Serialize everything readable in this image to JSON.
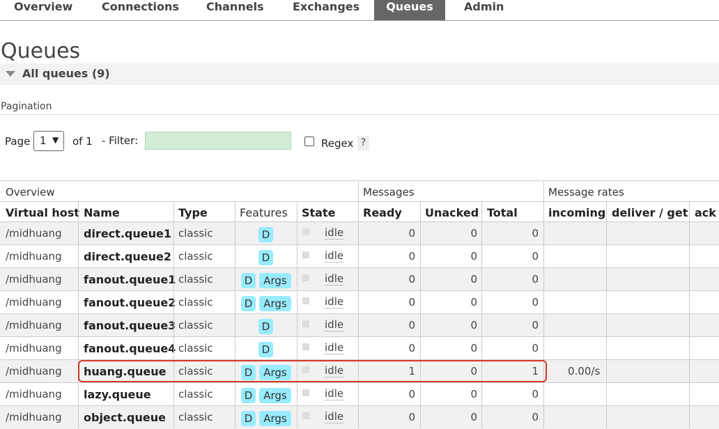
{
  "nav": {
    "tabs": [
      {
        "label": "Overview"
      },
      {
        "label": "Connections"
      },
      {
        "label": "Channels"
      },
      {
        "label": "Exchanges"
      },
      {
        "label": "Queues"
      },
      {
        "label": "Admin"
      }
    ],
    "active": "Queues"
  },
  "page": {
    "title": "Queues",
    "section_title": "All queues (9)"
  },
  "pagination": {
    "heading": "Pagination",
    "page_label": "Page",
    "page_value": "1",
    "of_label": "of 1",
    "filter_label": "- Filter:",
    "filter_value": "",
    "regex_label": "Regex",
    "regex_checked": false,
    "help_label": "?"
  },
  "table": {
    "groups": {
      "overview": "Overview",
      "messages": "Messages",
      "rates": "Message rates"
    },
    "columns": {
      "vhost": "Virtual host",
      "name": "Name",
      "type": "Type",
      "features": "Features",
      "state": "State",
      "ready": "Ready",
      "unacked": "Unacked",
      "total": "Total",
      "incoming": "incoming",
      "deliver": "deliver / get",
      "ack": "ack"
    },
    "rows": [
      {
        "vhost": "/midhuang",
        "name": "direct.queue1",
        "type": "classic",
        "d": "D",
        "args": "",
        "state": "idle",
        "ready": "0",
        "unacked": "0",
        "total": "0",
        "incoming": ""
      },
      {
        "vhost": "/midhuang",
        "name": "direct.queue2",
        "type": "classic",
        "d": "D",
        "args": "",
        "state": "idle",
        "ready": "0",
        "unacked": "0",
        "total": "0",
        "incoming": ""
      },
      {
        "vhost": "/midhuang",
        "name": "fanout.queue1",
        "type": "classic",
        "d": "D",
        "args": "Args",
        "state": "idle",
        "ready": "0",
        "unacked": "0",
        "total": "0",
        "incoming": ""
      },
      {
        "vhost": "/midhuang",
        "name": "fanout.queue2",
        "type": "classic",
        "d": "D",
        "args": "Args",
        "state": "idle",
        "ready": "0",
        "unacked": "0",
        "total": "0",
        "incoming": ""
      },
      {
        "vhost": "/midhuang",
        "name": "fanout.queue3",
        "type": "classic",
        "d": "D",
        "args": "",
        "state": "idle",
        "ready": "0",
        "unacked": "0",
        "total": "0",
        "incoming": ""
      },
      {
        "vhost": "/midhuang",
        "name": "fanout.queue4",
        "type": "classic",
        "d": "D",
        "args": "",
        "state": "idle",
        "ready": "0",
        "unacked": "0",
        "total": "0",
        "incoming": ""
      },
      {
        "vhost": "/midhuang",
        "name": "huang.queue",
        "type": "classic",
        "d": "D",
        "args": "Args",
        "state": "idle",
        "ready": "1",
        "unacked": "0",
        "total": "1",
        "incoming": "0.00/s"
      },
      {
        "vhost": "/midhuang",
        "name": "lazy.queue",
        "type": "classic",
        "d": "D",
        "args": "Args",
        "state": "idle",
        "ready": "0",
        "unacked": "0",
        "total": "0",
        "incoming": ""
      },
      {
        "vhost": "/midhuang",
        "name": "object.queue",
        "type": "classic",
        "d": "D",
        "args": "Args",
        "state": "idle",
        "ready": "0",
        "unacked": "0",
        "total": "0",
        "incoming": ""
      }
    ]
  },
  "colors": {
    "active_tab": "#666666",
    "badge": "#99ebff",
    "filter_bg": "#d1ecd7",
    "highlight": "#d33a2c"
  }
}
